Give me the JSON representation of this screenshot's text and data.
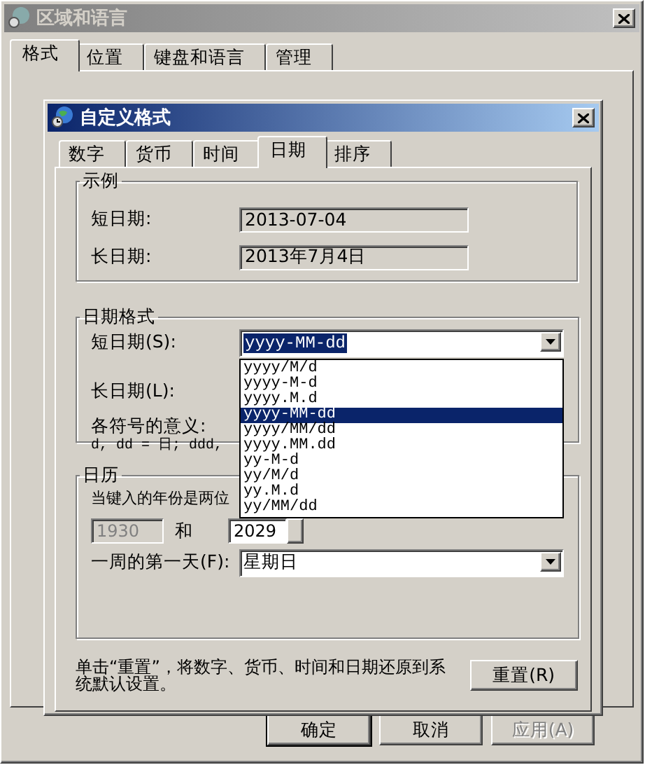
{
  "window": {
    "title": "区域和语言",
    "tabs": [
      {
        "label": "格式",
        "selected": true
      },
      {
        "label": "位置",
        "selected": false
      },
      {
        "label": "键盘和语言",
        "selected": false
      },
      {
        "label": "管理",
        "selected": false
      }
    ],
    "buttons": [
      {
        "label": "确定",
        "default": true,
        "disabled": false
      },
      {
        "label": "取消",
        "default": false,
        "disabled": false
      },
      {
        "label": "应用(A)",
        "default": false,
        "disabled": true
      }
    ]
  },
  "dialog": {
    "title": "自定义格式",
    "tabs": [
      {
        "label": "数字",
        "selected": false
      },
      {
        "label": "货币",
        "selected": false
      },
      {
        "label": "时间",
        "selected": false
      },
      {
        "label": "日期",
        "selected": true
      },
      {
        "label": "排序",
        "selected": false
      }
    ],
    "example": {
      "title": "示例",
      "rows": [
        {
          "label": "短日期:",
          "value": "2013-07-04"
        },
        {
          "label": "长日期:",
          "value": "2013年7月4日"
        }
      ]
    },
    "date_formats": {
      "title": "日期格式",
      "short_label": "短日期(S):",
      "short_value": "yyyy-MM-dd",
      "long_label": "长日期(L):",
      "legend_title": "各符号的意义:",
      "legend_text": "d, dd = 日;  ddd,"
    },
    "short_date_list": [
      {
        "label": "yyyy/M/d",
        "selected": false
      },
      {
        "label": "yyyy-M-d",
        "selected": false
      },
      {
        "label": "yyyy.M.d",
        "selected": false
      },
      {
        "label": "yyyy-MM-dd",
        "selected": true
      },
      {
        "label": "yyyy/MM/dd",
        "selected": false
      },
      {
        "label": "yyyy.MM.dd",
        "selected": false
      },
      {
        "label": "yy-M-d",
        "selected": false
      },
      {
        "label": "yy/M/d",
        "selected": false
      },
      {
        "label": "yy.M.d",
        "selected": false
      },
      {
        "label": "yy/MM/dd",
        "selected": false
      }
    ],
    "calendar": {
      "title": "日历",
      "two_digit_text": "当键入的年份是两位",
      "year_from": {
        "value": "1930",
        "disabled": true
      },
      "and": "和",
      "year_to": "2029",
      "first_day_label": "一周的第一天(F):",
      "first_day_value": "星期日"
    },
    "reset_text": "单击“重置”，将数字、货币、时间和日期还原到系统默认设置。",
    "reset_button": "重置(R)"
  }
}
